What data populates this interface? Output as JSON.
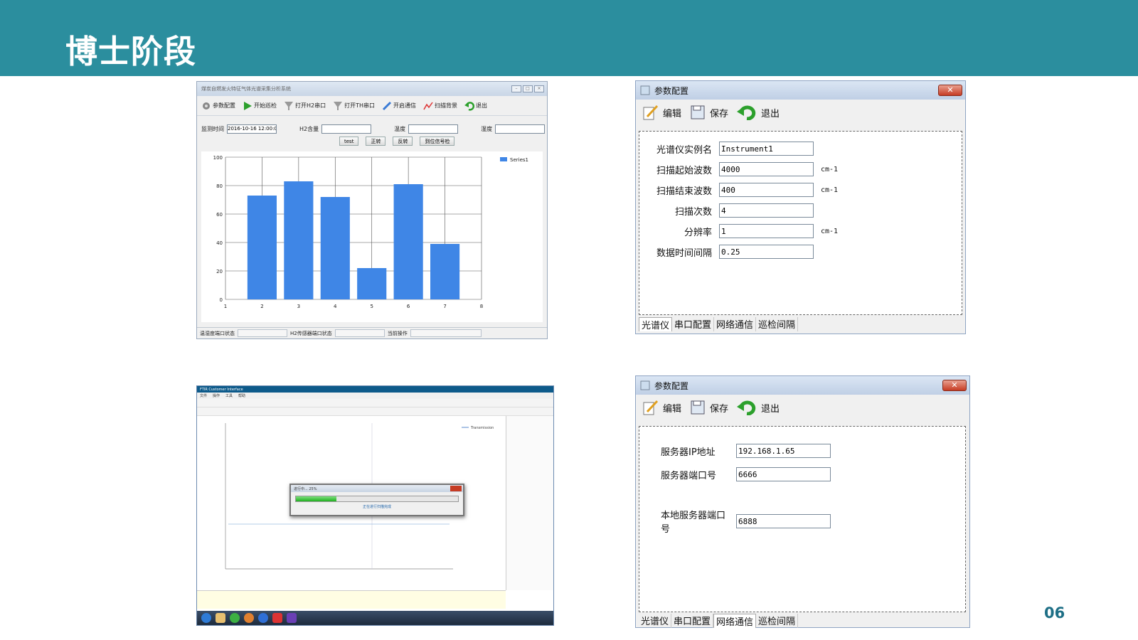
{
  "slide": {
    "title": "博士阶段",
    "page_number": "06"
  },
  "window1": {
    "title": "煤炭自燃发火特征气体光谱采集分析系统",
    "toolbar": [
      "参数配置",
      "开始巡检",
      "打开H2串口",
      "打开TH串口",
      "开启通信",
      "扫描背景",
      "退出"
    ],
    "fields": {
      "time_label": "监测时间",
      "time_value": "2016-10-16 12:00:01",
      "h2_label": "H2含量",
      "temp_label": "温度",
      "humidity_label": "湿度"
    },
    "buttons": [
      "test",
      "正转",
      "反转",
      "到位信号检"
    ],
    "status": [
      "温湿度端口状态",
      "H2传感器端口状态",
      "当前操作"
    ]
  },
  "dialog1": {
    "title": "参数配置",
    "toolbar": [
      "编辑",
      "保存",
      "退出"
    ],
    "rows": [
      {
        "label": "光谱仪实例名",
        "value": "Instrument1",
        "unit": ""
      },
      {
        "label": "扫描起始波数",
        "value": "4000",
        "unit": "cm-1"
      },
      {
        "label": "扫描结束波数",
        "value": "400",
        "unit": "cm-1"
      },
      {
        "label": "扫描次数",
        "value": "4",
        "unit": ""
      },
      {
        "label": "分辨率",
        "value": "1",
        "unit": "cm-1"
      },
      {
        "label": "数据时间间隔",
        "value": "0.25",
        "unit": ""
      }
    ],
    "tabs": [
      "光谱仪",
      "串口配置",
      "网络通信",
      "巡检间隔"
    ],
    "active_tab": 0
  },
  "dialog2": {
    "title": "参数配置",
    "toolbar": [
      "编辑",
      "保存",
      "退出"
    ],
    "rows": [
      {
        "label": "服务器IP地址",
        "value": "192.168.1.65"
      },
      {
        "label": "服务器端口号",
        "value": "6666"
      },
      {
        "label": "本地服务器端口号",
        "value": "6888"
      }
    ],
    "tabs": [
      "光谱仪",
      "串口配置",
      "网络通信",
      "巡检间隔"
    ],
    "active_tab": 2
  },
  "window3": {
    "title": "FTIR Customer Interface",
    "menu": [
      "文件",
      "操作",
      "工具",
      "帮助"
    ],
    "legend": "Transmission",
    "progress_title": "进行中... 25%",
    "progress_value": 0.25,
    "progress_message": "正在进行扫描完成"
  },
  "chart_data": {
    "type": "bar",
    "categories": [
      "2",
      "3",
      "4",
      "5",
      "6",
      "7"
    ],
    "series": [
      {
        "name": "Series1",
        "values": [
          73,
          83,
          72,
          22,
          81,
          39
        ]
      }
    ],
    "xlim": [
      1,
      8
    ],
    "ylim": [
      0,
      100
    ],
    "xticks": [
      "1",
      "2",
      "3",
      "4",
      "5",
      "6",
      "7",
      "8"
    ],
    "yticks": [
      "0",
      "20",
      "40",
      "60",
      "80",
      "100"
    ],
    "legend_position": "top-right",
    "grid": true,
    "color": "#3f86e6"
  }
}
